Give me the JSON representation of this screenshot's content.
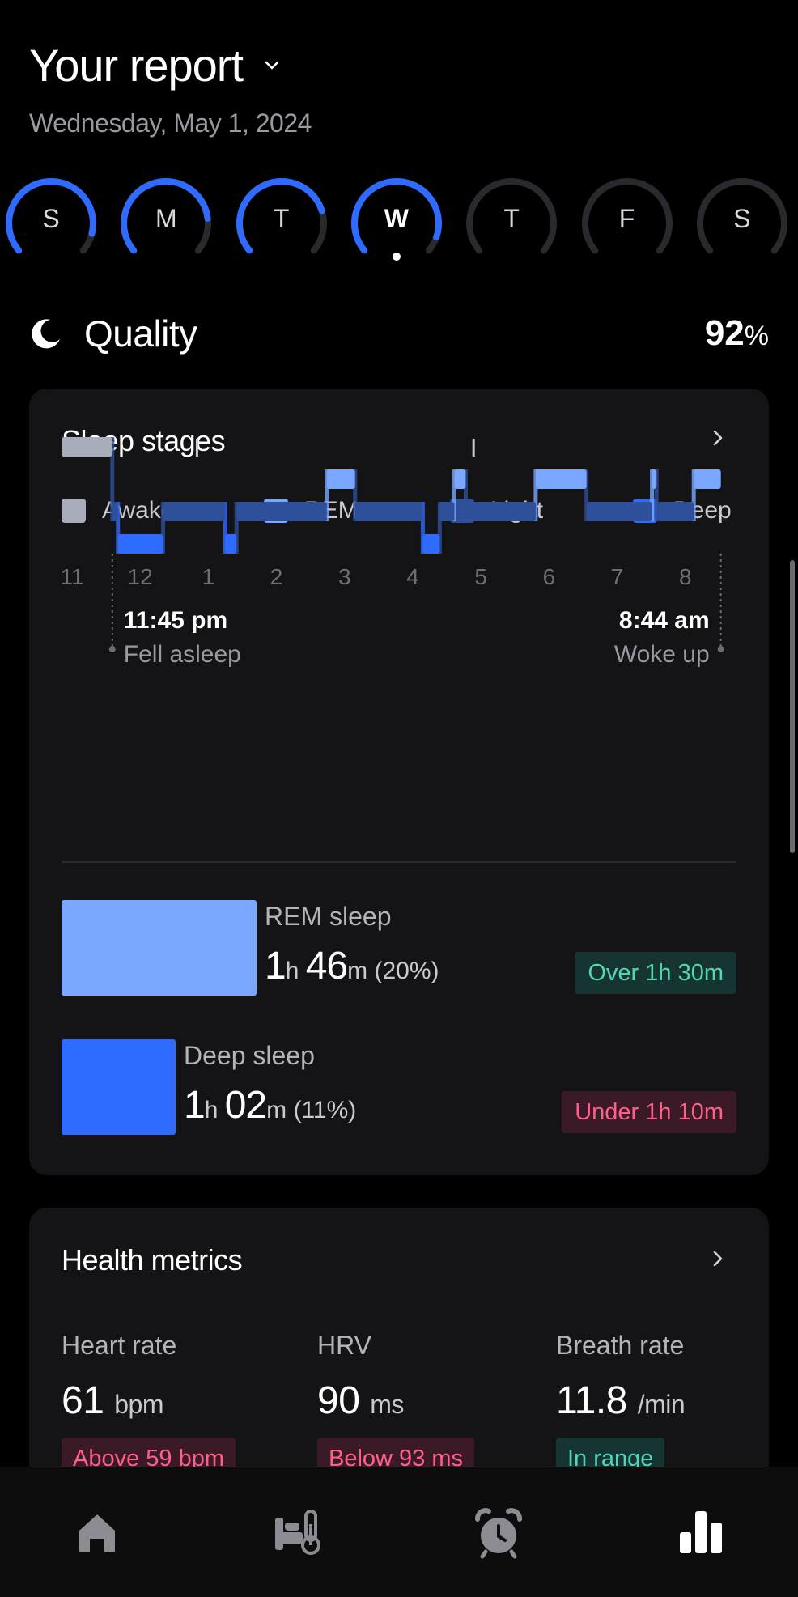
{
  "header": {
    "title": "Your report",
    "date": "Wednesday, May 1, 2024"
  },
  "days": [
    {
      "label": "S",
      "progress": 0.9,
      "selected": false
    },
    {
      "label": "M",
      "progress": 0.82,
      "selected": false
    },
    {
      "label": "T",
      "progress": 0.78,
      "selected": false
    },
    {
      "label": "W",
      "progress": 0.92,
      "selected": true
    },
    {
      "label": "T",
      "progress": 0,
      "selected": false
    },
    {
      "label": "F",
      "progress": 0,
      "selected": false
    },
    {
      "label": "S",
      "progress": 0,
      "selected": false
    }
  ],
  "quality": {
    "label": "Quality",
    "value": "92",
    "unit": "%"
  },
  "sleep_stages": {
    "title": "Sleep stages",
    "legend": [
      {
        "name": "Awake",
        "color": "#a9adbb"
      },
      {
        "name": "REM",
        "color": "#7aa7ff"
      },
      {
        "name": "Light",
        "color": "#2e4f9a"
      },
      {
        "name": "Deep",
        "color": "#2f6bff"
      }
    ],
    "hours": [
      "11",
      "12",
      "1",
      "2",
      "3",
      "4",
      "5",
      "6",
      "7",
      "8"
    ],
    "fell_asleep": {
      "time": "11:45 pm",
      "label": "Fell asleep"
    },
    "woke_up": {
      "time": "8:44 am",
      "label": "Woke up"
    },
    "rem": {
      "name": "REM sleep",
      "h": "1",
      "m": "46",
      "pct": "(20%)",
      "badge": "Over 1h 30m",
      "minutes": 106
    },
    "deep": {
      "name": "Deep sleep",
      "h": "1",
      "m": "02",
      "pct": "(11%)",
      "badge": "Under 1h 10m",
      "minutes": 62
    }
  },
  "chart_data": {
    "type": "hypnogram",
    "x_unit": "clock time",
    "start": "11:45 pm",
    "end": "8:44 am",
    "stages": [
      "Awake",
      "REM",
      "Light",
      "Deep"
    ],
    "segments": [
      {
        "stage": "Awake",
        "from": "11:00 pm",
        "to": "11:45 pm"
      },
      {
        "stage": "Light",
        "from": "11:45 pm",
        "to": "11:50 pm"
      },
      {
        "stage": "Deep",
        "from": "11:50 pm",
        "to": "12:30 am"
      },
      {
        "stage": "Light",
        "from": "12:30 am",
        "to": "1:25 am"
      },
      {
        "stage": "Deep",
        "from": "1:25 am",
        "to": "1:35 am"
      },
      {
        "stage": "Light",
        "from": "1:35 am",
        "to": "2:55 am"
      },
      {
        "stage": "REM",
        "from": "2:55 am",
        "to": "3:20 am"
      },
      {
        "stage": "Light",
        "from": "3:20 am",
        "to": "4:20 am"
      },
      {
        "stage": "Deep",
        "from": "4:20 am",
        "to": "4:35 am"
      },
      {
        "stage": "Light",
        "from": "4:35 am",
        "to": "4:48 am"
      },
      {
        "stage": "REM",
        "from": "4:48 am",
        "to": "4:58 am"
      },
      {
        "stage": "Light",
        "from": "4:58 am",
        "to": "6:00 am"
      },
      {
        "stage": "REM",
        "from": "6:00 am",
        "to": "6:45 am"
      },
      {
        "stage": "Light",
        "from": "6:45 am",
        "to": "7:43 am"
      },
      {
        "stage": "REM",
        "from": "7:43 am",
        "to": "7:47 am"
      },
      {
        "stage": "Light",
        "from": "7:47 am",
        "to": "8:20 am"
      },
      {
        "stage": "REM",
        "from": "8:20 am",
        "to": "8:44 am"
      }
    ],
    "awake_ticks": [
      "1:00 am",
      "5:05 am"
    ]
  },
  "health_metrics": {
    "title": "Health metrics",
    "items": [
      {
        "label": "Heart rate",
        "value": "61",
        "unit": "bpm",
        "badge": "Above 59 bpm",
        "status": "bad"
      },
      {
        "label": "HRV",
        "value": "90",
        "unit": "ms",
        "badge": "Below 93 ms",
        "status": "bad"
      },
      {
        "label": "Breath rate",
        "value": "11.8",
        "unit": "/min",
        "badge": "In range",
        "status": "good"
      }
    ]
  },
  "colors": {
    "accent": "#2f6bff",
    "good_bg": "#163532",
    "good_fg": "#52d6b8",
    "bad_bg": "#3a1a26",
    "bad_fg": "#ff5f88"
  },
  "nav": [
    {
      "name": "home-icon"
    },
    {
      "name": "bed-temperature-icon"
    },
    {
      "name": "alarm-clock-icon"
    },
    {
      "name": "reports-icon",
      "active": true
    }
  ]
}
